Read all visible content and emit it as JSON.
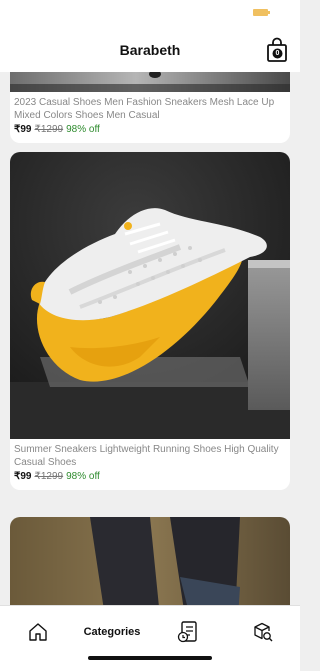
{
  "header": {
    "title": "Barabeth",
    "cart_count": "0"
  },
  "products": [
    {
      "title": "2023 Casual Shoes Men Fashion Sneakers Mesh Lace Up Mixed Colors Shoes Men Casual",
      "price": "₹99",
      "mrp": "₹1299",
      "discount": "98% off"
    },
    {
      "title": "Summer Sneakers Lightweight Running Shoes High Quality Casual Shoes",
      "price": "₹99",
      "mrp": "₹1299",
      "discount": "98% off"
    }
  ],
  "bottom_nav": {
    "categories_label": "Categories"
  },
  "colors": {
    "accent": "#f4b400",
    "discount": "#2e8b2e"
  }
}
